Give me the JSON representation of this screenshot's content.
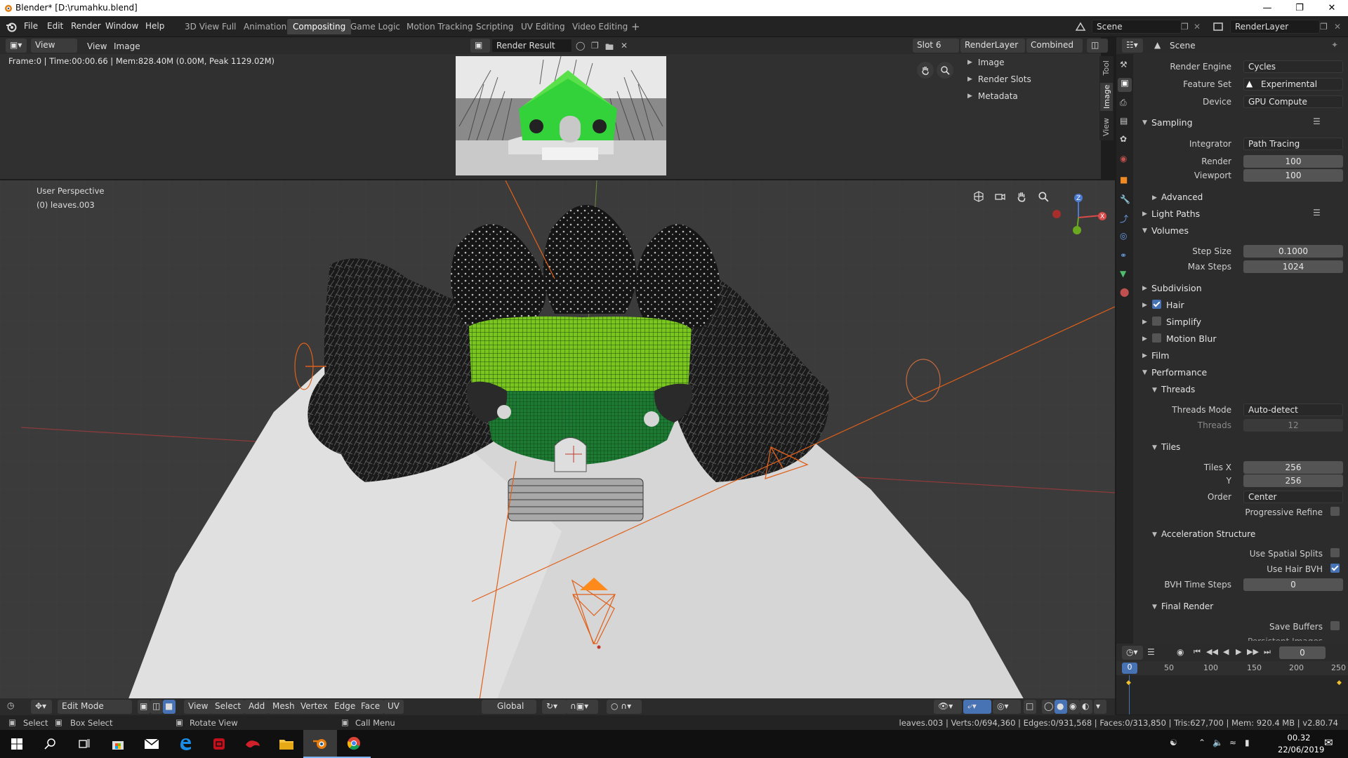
{
  "window": {
    "title": "Blender* [D:\\rumahku.blend]"
  },
  "menu": {
    "items": [
      "File",
      "Edit",
      "Render",
      "Window",
      "Help"
    ]
  },
  "workspaces": {
    "tabs": [
      "3D View Full",
      "Animation",
      "Compositing",
      "Game Logic",
      "Motion Tracking",
      "Scripting",
      "UV Editing",
      "Video Editing"
    ],
    "active": "Compositing",
    "add": "+"
  },
  "scene": {
    "name": "Scene",
    "render_layer": "RenderLayer"
  },
  "image_editor": {
    "view": "View",
    "menu_view": "View",
    "menu_image": "Image",
    "image_name": "Render Result",
    "slot": "Slot 6",
    "layer": "RenderLayer",
    "pass": "Combined",
    "info": "Frame:0 | Time:00:00.66 | Mem:828.40M (0.00M, Peak 1129.02M)",
    "sidebar_items": [
      "Image",
      "Render Slots",
      "Metadata"
    ],
    "side_tabs": [
      "Tool",
      "Image",
      "View"
    ]
  },
  "viewport": {
    "perspective": "User Perspective",
    "object": "(0) leaves.003"
  },
  "properties": {
    "scene_label": "Scene",
    "render_engine": {
      "label": "Render Engine",
      "value": "Cycles"
    },
    "feature_set": {
      "label": "Feature Set",
      "value": "Experimental"
    },
    "device": {
      "label": "Device",
      "value": "GPU Compute"
    },
    "sampling": {
      "title": "Sampling",
      "integrator_label": "Integrator",
      "integrator": "Path Tracing",
      "render_label": "Render",
      "render": "100",
      "viewport_label": "Viewport",
      "viewport": "100",
      "advanced": "Advanced"
    },
    "light_paths": "Light Paths",
    "volumes": {
      "title": "Volumes",
      "step_size_label": "Step Size",
      "step_size": "0.1000",
      "max_steps_label": "Max Steps",
      "max_steps": "1024"
    },
    "subdivision": "Subdivision",
    "hair": {
      "label": "Hair",
      "checked": true
    },
    "simplify": {
      "label": "Simplify",
      "checked": false
    },
    "motion_blur": {
      "label": "Motion Blur",
      "checked": false
    },
    "film": "Film",
    "performance": {
      "title": "Performance",
      "threads": {
        "title": "Threads",
        "mode_label": "Threads Mode",
        "mode": "Auto-detect",
        "count_label": "Threads",
        "count": "12"
      },
      "tiles": {
        "title": "Tiles",
        "x_label": "Tiles X",
        "x": "256",
        "y_label": "Y",
        "y": "256",
        "order_label": "Order",
        "order": "Center",
        "progressive_label": "Progressive Refine"
      },
      "accel": {
        "title": "Acceleration Structure",
        "spatial_label": "Use Spatial Splits",
        "hair_bvh_label": "Use Hair BVH",
        "bvh_steps_label": "BVH Time Steps",
        "bvh_steps": "0"
      },
      "final_render": {
        "title": "Final Render",
        "save_buffers": "Save Buffers",
        "persistent": "Persistent Images"
      }
    }
  },
  "timeline": {
    "current_frame": "0",
    "ruler": [
      "0",
      "50",
      "100",
      "150",
      "200",
      "250"
    ]
  },
  "viewport_header": {
    "mode": "Edit Mode",
    "menus": [
      "View",
      "Select",
      "Add",
      "Mesh",
      "Vertex",
      "Edge",
      "Face",
      "UV"
    ],
    "orientation": "Global"
  },
  "statusbar": {
    "select": "Select",
    "box_select": "Box Select",
    "rotate": "Rotate View",
    "call_menu": "Call Menu",
    "stats": "leaves.003 | Verts:0/694,360 | Edges:0/931,568 | Faces:0/313,850 | Tris:627,700 | Mem: 920.4 MB | v2.80.74"
  },
  "taskbar": {
    "time": "00.32",
    "date": "22/06/2019"
  },
  "colors": {
    "accent": "#4772b3",
    "active_orange": "#ff8a1c",
    "lamp": "#e0601a"
  }
}
